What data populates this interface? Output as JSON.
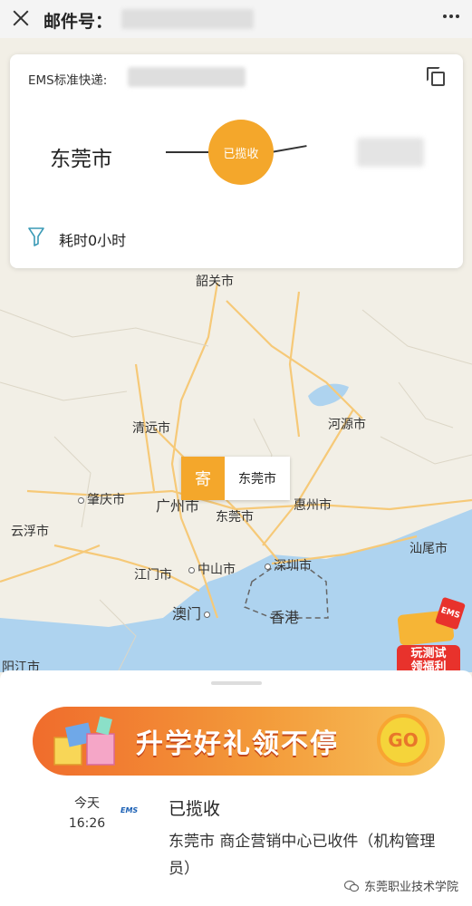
{
  "header": {
    "title": "邮件号："
  },
  "card": {
    "service_label": "EMS标准快递:",
    "origin": "东莞市",
    "status": "已揽收",
    "duration": "耗时0小时"
  },
  "map": {
    "cities": [
      {
        "id": "shaoguan",
        "name": "韶关市"
      },
      {
        "id": "qingyuan",
        "name": "清远市"
      },
      {
        "id": "heyuan",
        "name": "河源市"
      },
      {
        "id": "zhaoqing",
        "name": "肇庆市"
      },
      {
        "id": "guangzhou",
        "name": "广州市"
      },
      {
        "id": "dongguan",
        "name": "东莞市"
      },
      {
        "id": "huizhou",
        "name": "惠州市"
      },
      {
        "id": "yunfu",
        "name": "云浮市"
      },
      {
        "id": "shanwei",
        "name": "汕尾市"
      },
      {
        "id": "jiangmen",
        "name": "江门市"
      },
      {
        "id": "zhongshan",
        "name": "中山市"
      },
      {
        "id": "shenzhen",
        "name": "深圳市"
      },
      {
        "id": "macau",
        "name": "澳门"
      },
      {
        "id": "hongkong",
        "name": "香港"
      },
      {
        "id": "yangjiang",
        "name": "阳江市"
      }
    ],
    "pin": {
      "tag": "寄",
      "city": "东莞市"
    }
  },
  "promo_float": {
    "badge": "EMS",
    "line1": "玩测试",
    "line2": "领福利"
  },
  "banner": {
    "text": "升学好礼领不停",
    "go": "GO"
  },
  "timeline": {
    "date": "今天",
    "time": "16:26",
    "logo": "EMS",
    "title": "已揽收",
    "description": "东莞市 商企营销中心已收件（机构管理员）"
  },
  "watermark": "东莞职业技术学院",
  "colors": {
    "accent": "#f4a72b",
    "banner": "#f06c2c",
    "water": "#aed3ef"
  }
}
